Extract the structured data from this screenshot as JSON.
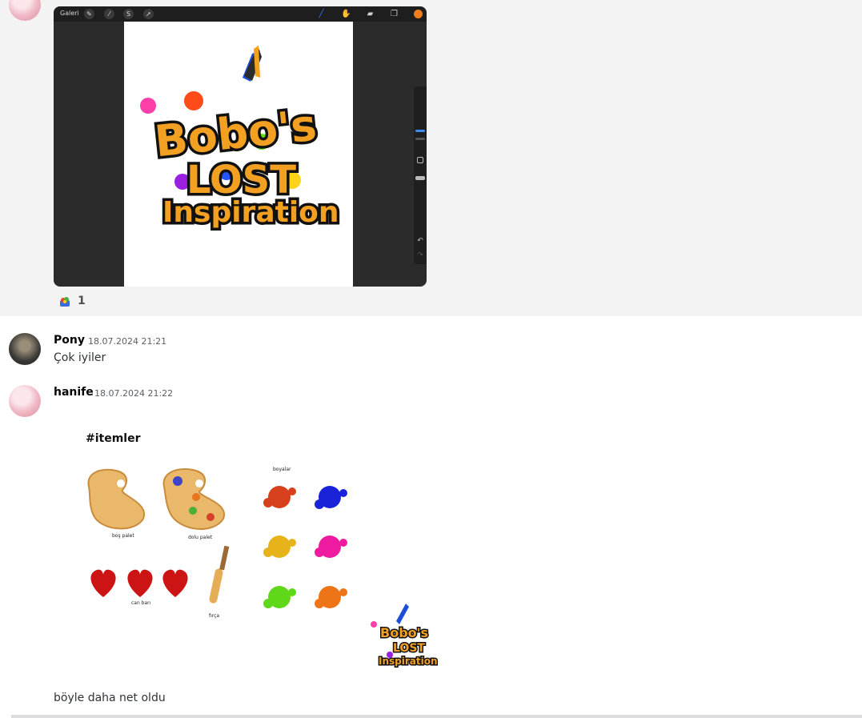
{
  "procreate": {
    "gallery_label": "Galeri",
    "toolbar_left_icons": [
      "wrench-icon",
      "magic-wand-icon",
      "selection-icon",
      "transform-arrow-icon"
    ],
    "toolbar_right_icons": [
      "brush-icon",
      "smudge-icon",
      "eraser-icon",
      "layers-icon"
    ],
    "current_color": "#f27d1b"
  },
  "artwork": {
    "logo_line1": "Bobo's",
    "logo_line2": "LOST",
    "logo_line3": "Inspiration"
  },
  "reaction": {
    "count": "1"
  },
  "messages": [
    {
      "author": "Pony",
      "timestamp": "18.07.2024 21:21",
      "text": "Çok iyiler"
    },
    {
      "author": "hanife",
      "timestamp": "18.07.2024 21:22",
      "text": "böyle daha net oldu"
    }
  ],
  "items_sheet": {
    "title": "#itemler",
    "labels": {
      "empty_palette": "boş palet",
      "full_palette": "dolu palet",
      "health_bar": "can barı",
      "brush": "fırça",
      "paints": "boyalar"
    },
    "logo_line1": "Bobo's",
    "logo_line2": "LOST",
    "logo_line3": "Inspiration"
  }
}
